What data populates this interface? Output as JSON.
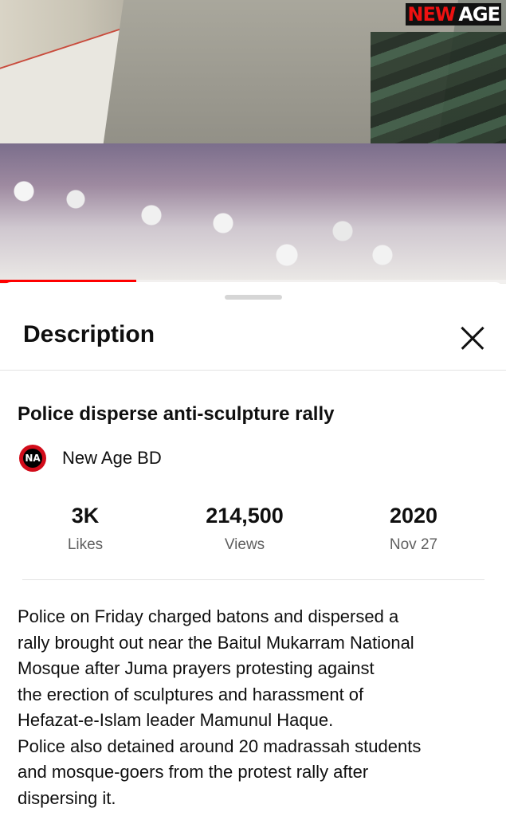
{
  "video": {
    "logo_new": "NEW",
    "logo_age": "AGE",
    "progress": 0.27
  },
  "sheet": {
    "header_title": "Description"
  },
  "video_info": {
    "title": "Police disperse anti-sculpture rally",
    "channel_name": "New Age BD",
    "channel_avatar_text": "NA"
  },
  "stats": [
    {
      "value": "3K",
      "label": "Likes"
    },
    {
      "value": "214,500",
      "label": "Views"
    },
    {
      "value": "2020",
      "label": "Nov 27"
    }
  ],
  "description": {
    "lines": [
      "Police on Friday charged batons and dispersed a",
      "rally brought out near the Baitul Mukarram National",
      "Mosque after Juma prayers protesting against",
      "the erection of sculptures and harassment of",
      "Hefazat-e-Islam leader Mamunul Haque.",
      "Police also detained around 20 madrassah students",
      "and mosque-goers from the protest rally after",
      "dispersing it."
    ]
  },
  "colors": {
    "accent": "#ff0000",
    "avatar_bg": "#d20c1a",
    "secondary_text": "#606060"
  },
  "icons": {
    "close": "close-icon"
  }
}
